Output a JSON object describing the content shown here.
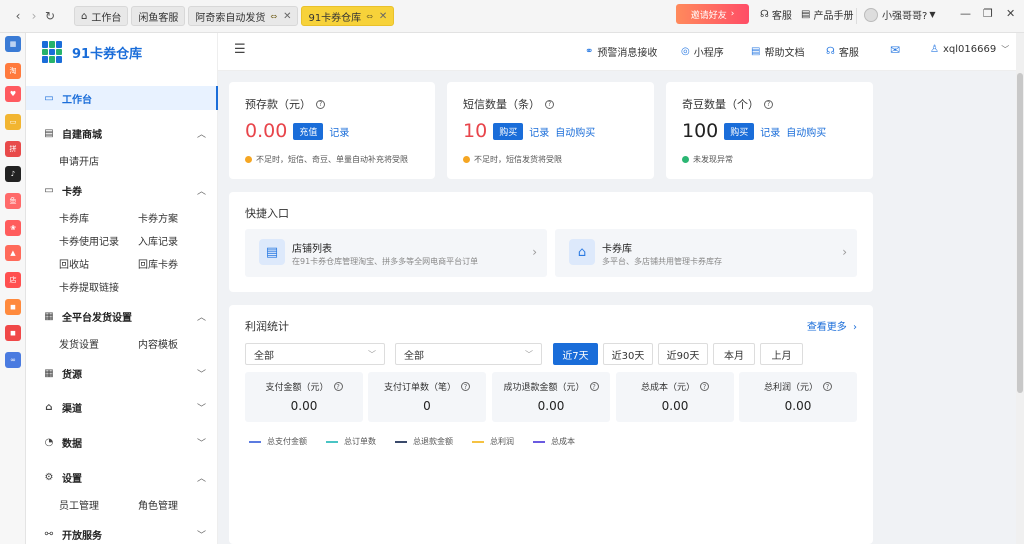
{
  "titlebar": {
    "tabs": [
      {
        "label": "工作台",
        "icon": "home-icon"
      },
      {
        "label": "闲鱼客服"
      },
      {
        "label": "阿奇索自动发货",
        "closable": true
      },
      {
        "label": "91卡券仓库",
        "closable": true,
        "active": true
      }
    ],
    "invite_label": "邀请好友",
    "service_label": "客服",
    "manual_label": "产品手册",
    "user_label": "小强哥哥?"
  },
  "appbar_icons": [
    {
      "name": "qr-app-icon",
      "color": "#3a7bd5",
      "glyph": "▦"
    },
    {
      "name": "taobao-app-icon",
      "color": "#ff7a3d",
      "glyph": "淘"
    },
    {
      "name": "heart-app-icon",
      "color": "#ff5a5f",
      "glyph": "♥"
    },
    {
      "name": "yellow-app-icon",
      "color": "#f2b531",
      "glyph": "▭"
    },
    {
      "name": "pdd-app-icon",
      "color": "#e84a4a",
      "glyph": "拼"
    },
    {
      "name": "tiktok-app-icon",
      "color": "#222222",
      "glyph": "♪"
    },
    {
      "name": "xianyu-app-icon",
      "color": "#ff6a6a",
      "glyph": "鱼"
    },
    {
      "name": "red-app-icon",
      "color": "#ff5c5c",
      "glyph": "❀"
    },
    {
      "name": "thumb-app-icon",
      "color": "#ff6a5a",
      "glyph": "▲"
    },
    {
      "name": "store-app-icon",
      "color": "#ff5050",
      "glyph": "店"
    },
    {
      "name": "orange-app-icon",
      "color": "#ff8a3d",
      "glyph": "◼"
    },
    {
      "name": "red2-app-icon",
      "color": "#f04848",
      "glyph": "◼"
    },
    {
      "name": "link-app-icon",
      "color": "#4a7be0",
      "glyph": "∞"
    }
  ],
  "sidebar": {
    "logo_text": "91卡券仓库",
    "workbench": "工作台",
    "mall": "自建商城",
    "mall_items": [
      "申请开店"
    ],
    "card": "卡券",
    "card_items": [
      "卡券库",
      "卡券方案",
      "卡券使用记录",
      "入库记录",
      "回收站",
      "回库卡券",
      "卡券提取链接"
    ],
    "dispatch": "全平台发货设置",
    "dispatch_items": [
      "发货设置",
      "内容模板"
    ],
    "source": "货源",
    "channel": "渠道",
    "data": "数据",
    "settings": "设置",
    "settings_items": [
      "员工管理",
      "角色管理"
    ],
    "open_service": "开放服务"
  },
  "header": {
    "alert": "预警消息接收",
    "mini": "小程序",
    "help": "帮助文档",
    "service": "客服",
    "account": "xql016669"
  },
  "stats": [
    {
      "title": "预存款（元）",
      "value": "0.00",
      "button": "充值",
      "link1": "记录",
      "link2": "",
      "note": "不足时，短信、奇豆、单量自动补充将受限",
      "note_color": "#f5a623"
    },
    {
      "title": "短信数量（条）",
      "value": "10",
      "button": "购买",
      "link1": "记录",
      "link2": "自动购买",
      "note": "不足时，短信发货将受限",
      "note_color": "#f5a623"
    },
    {
      "title": "奇豆数量（个）",
      "value": "100",
      "button": "购买",
      "link1": "记录",
      "link2": "自动购买",
      "note": "未发现异常",
      "note_color": "#2bb673"
    }
  ],
  "quick": {
    "title": "快捷入口",
    "items": [
      {
        "title": "店铺列表",
        "desc": "在91卡券仓库管理淘宝、拼多多等全网电商平台订单"
      },
      {
        "title": "卡券库",
        "desc": "多平台、多店铺共用管理卡券库存"
      }
    ]
  },
  "profit": {
    "title": "利润统计",
    "more": "查看更多",
    "select1": "全部",
    "select2": "全部",
    "ranges": [
      "近7天",
      "近30天",
      "近90天",
      "本月",
      "上月"
    ],
    "kpis": [
      {
        "label": "支付金额（元）",
        "value": "0.00"
      },
      {
        "label": "支付订单数（笔）",
        "value": "0"
      },
      {
        "label": "成功退款金额（元）",
        "value": "0.00"
      },
      {
        "label": "总成本（元）",
        "value": "0.00"
      },
      {
        "label": "总利润（元）",
        "value": "0.00"
      }
    ],
    "legend": [
      {
        "label": "总支付金额",
        "color": "#5b7be0"
      },
      {
        "label": "总订单数",
        "color": "#49c4c4"
      },
      {
        "label": "总退款金额",
        "color": "#3a4a6b"
      },
      {
        "label": "总利润",
        "color": "#f5c242"
      },
      {
        "label": "总成本",
        "color": "#6a5ae0"
      }
    ]
  }
}
